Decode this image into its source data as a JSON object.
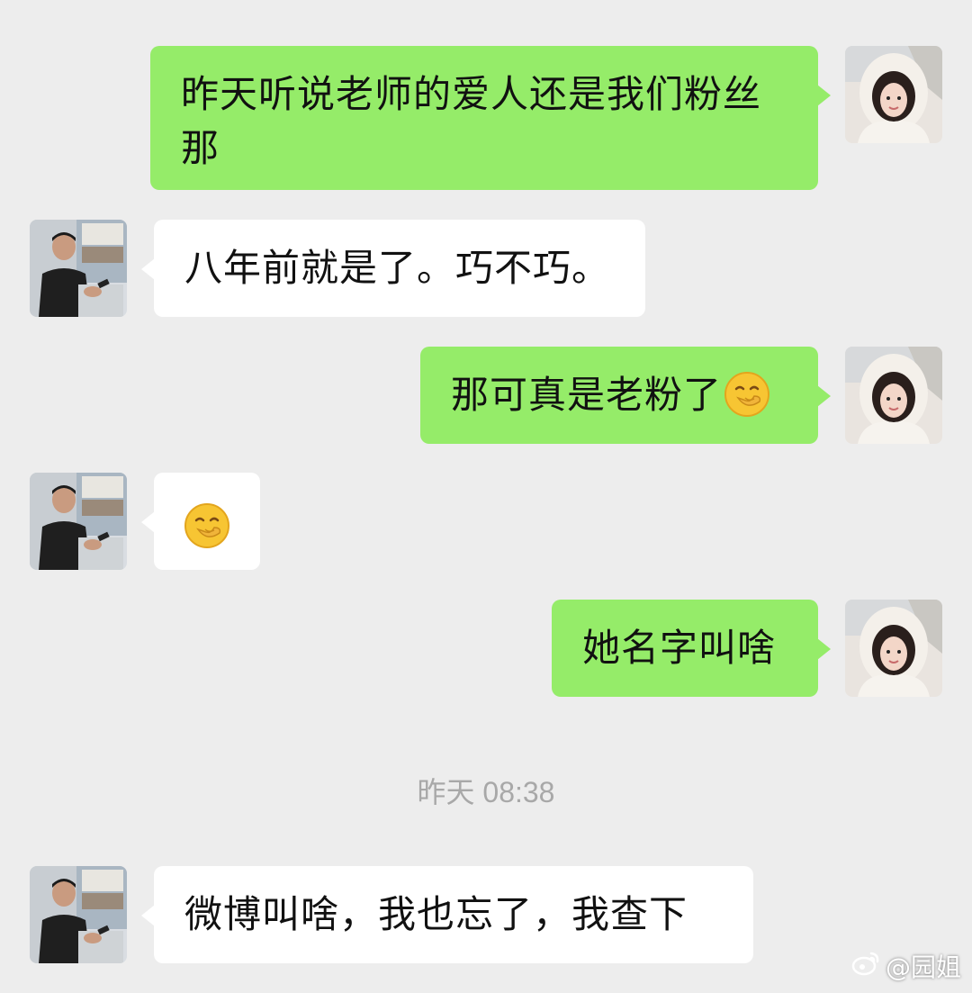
{
  "chat": {
    "messages": [
      {
        "sender": "self",
        "text": "昨天听说老师的爱人还是我们粉丝那"
      },
      {
        "sender": "other",
        "text": "八年前就是了。巧不巧。"
      },
      {
        "sender": "self",
        "text": "那可真是老粉了",
        "emoji": "smirk-hand-over-mouth-emoji"
      },
      {
        "sender": "other",
        "text": "",
        "emoji": "smirk-hand-over-mouth-emoji"
      },
      {
        "sender": "self",
        "text": "她名字叫啥"
      },
      {
        "sender": "other",
        "text": "微博叫啥，我也忘了，我查下"
      }
    ],
    "timestamp": "昨天 08:38"
  },
  "watermark": {
    "text": "@园姐",
    "icon": "weibo-icon"
  },
  "colors": {
    "background": "#ededed",
    "self_bubble": "#95ec69",
    "other_bubble": "#ffffff",
    "timestamp": "#a8a8a8"
  }
}
